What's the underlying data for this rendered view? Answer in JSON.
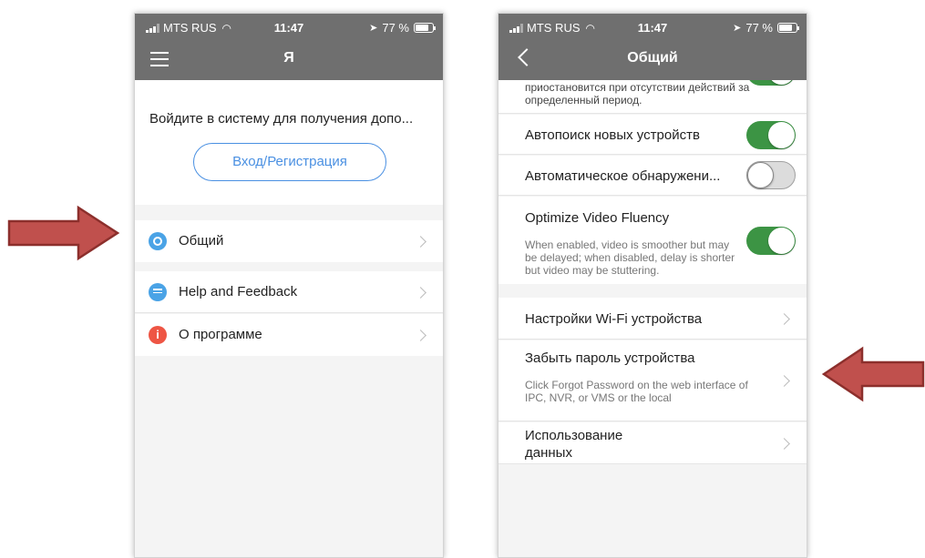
{
  "status_bar": {
    "carrier": "MTS RUS",
    "time": "11:47",
    "battery": "77 %",
    "battery_level": 0.77
  },
  "left_screen": {
    "title": "Я",
    "login_prompt": "Войдите в систему для получения допо...",
    "login_button": "Вход/Регистрация",
    "items": [
      {
        "label": "Общий",
        "icon": "gear-icon",
        "color": "#4aa3e6"
      },
      {
        "label": "Help and Feedback",
        "icon": "chat-icon",
        "color": "#4aa3e6"
      },
      {
        "label": "О программе",
        "icon": "info-icon",
        "color": "#ee5544",
        "glyph": "i"
      }
    ]
  },
  "right_screen": {
    "title": "Общий",
    "clipped_text": "приостановится при отсутствии действий за определенный период.",
    "settings": [
      {
        "label": "Автопоиск новых устройств",
        "toggle": true
      },
      {
        "label": "Автоматическое обнаружени...",
        "toggle": false
      },
      {
        "label": "Optimize Video Fluency",
        "toggle": true,
        "description": "When enabled, video is smoother but may be delayed; when disabled, delay is shorter but video may be stuttering."
      }
    ],
    "links": [
      {
        "label": "Настройки Wi-Fi устройства"
      },
      {
        "label": "Забыть пароль устройства",
        "description": "Click Forgot Password on the web interface of IPC, NVR, or VMS or the local"
      },
      {
        "label": "Использование данных"
      }
    ]
  },
  "colors": {
    "header": "#6f6f6f",
    "accent": "#4a90e2",
    "toggle_on": "#3c9444",
    "arrow": "#c0504d"
  }
}
